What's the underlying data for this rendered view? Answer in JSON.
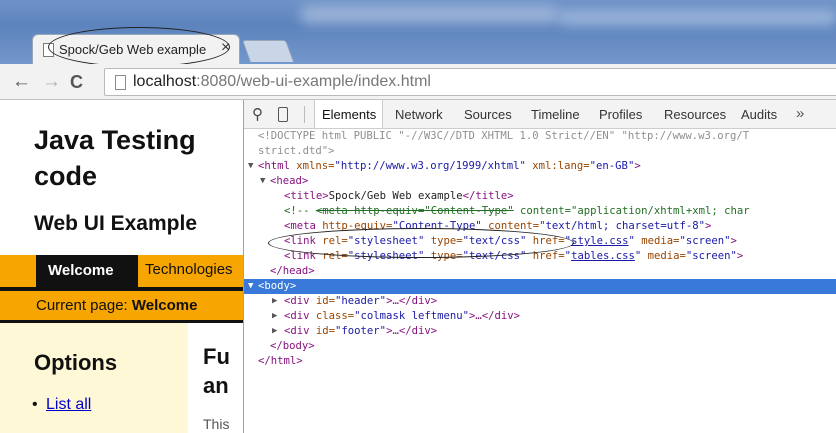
{
  "browser": {
    "tab": {
      "title": "Spock/Geb Web example",
      "close": "×"
    },
    "nav": {
      "back": "←",
      "forward": "→",
      "reload": "C"
    },
    "address": {
      "host": "localhost",
      "rest": ":8080/web-ui-example/index.html"
    }
  },
  "page": {
    "site_title_line1": "Java Testing",
    "site_title_line2": "code",
    "site_subtitle": "Web UI Example",
    "nav": {
      "welcome": "Welcome",
      "technologies": "Technologies"
    },
    "current_page": {
      "label": "Current page: ",
      "value": "Welcome"
    },
    "options": {
      "title": "Options",
      "link": "List all"
    },
    "main": {
      "heading_line1": "Fu",
      "heading_line2": "an",
      "text": "This"
    }
  },
  "devtools": {
    "tabs": [
      "Elements",
      "Network",
      "Sources",
      "Timeline",
      "Profiles",
      "Resources",
      "Audits"
    ],
    "more": "»",
    "dom": {
      "doctype1": "<!DOCTYPE html PUBLIC \"-//W3C//DTD XHTML 1.0 Strict//EN\" \"http://www.w3.org/T",
      "doctype2": "strict.dtd\">",
      "html_open": "<html",
      "html_attr1_name": " xmlns=",
      "html_attr1_value": "\"http://www.w3.org/1999/xhtml\"",
      "html_attr2_name": " xml:lang=",
      "html_attr2_value": "\"en-GB\"",
      "html_close_bracket": ">",
      "head_open": "<head>",
      "title_open": "<title>",
      "title_text": "Spock/Geb Web example",
      "title_close": "</title>",
      "comment_start": "<!-- ",
      "comment_struck": "<meta http-equiv=\"Content-Type\"",
      "comment_rest": " content=\"application/xhtml+xml; char",
      "meta_open": "<meta",
      "meta_attr1_name": " http-equiv=",
      "meta_attr1_value": "\"Content-Type\"",
      "meta_attr2_name": " content=",
      "meta_attr2_value": "\"text/html; charset=utf-8\"",
      "meta_close": ">",
      "link_open": "<link",
      "link_rel_name": " rel=",
      "link_rel_value": "\"stylesheet\"",
      "link_type_name": " type=",
      "link_type_value": "\"text/css\"",
      "link_href_name": " href=",
      "link1_q1": "\"",
      "link1_href": "style.css",
      "link1_q2": "\"",
      "link2_href": "tables.css",
      "link_media_name": " media=",
      "link_media_value": "\"screen\"",
      "link_close": ">",
      "head_close": "</head>",
      "body_open": "<body>",
      "div_open": "<div",
      "div_id_name": " id=",
      "div_header_value": "\"header\"",
      "div_class_name": " class=",
      "div_colmask_value": "\"colmask leftmenu\"",
      "div_footer_value": "\"footer\"",
      "div_ellipsis": ">…</div>",
      "body_close": "</body>",
      "html_close": "</html>",
      "tri_open": "▼",
      "tri_closed": "▶"
    }
  }
}
